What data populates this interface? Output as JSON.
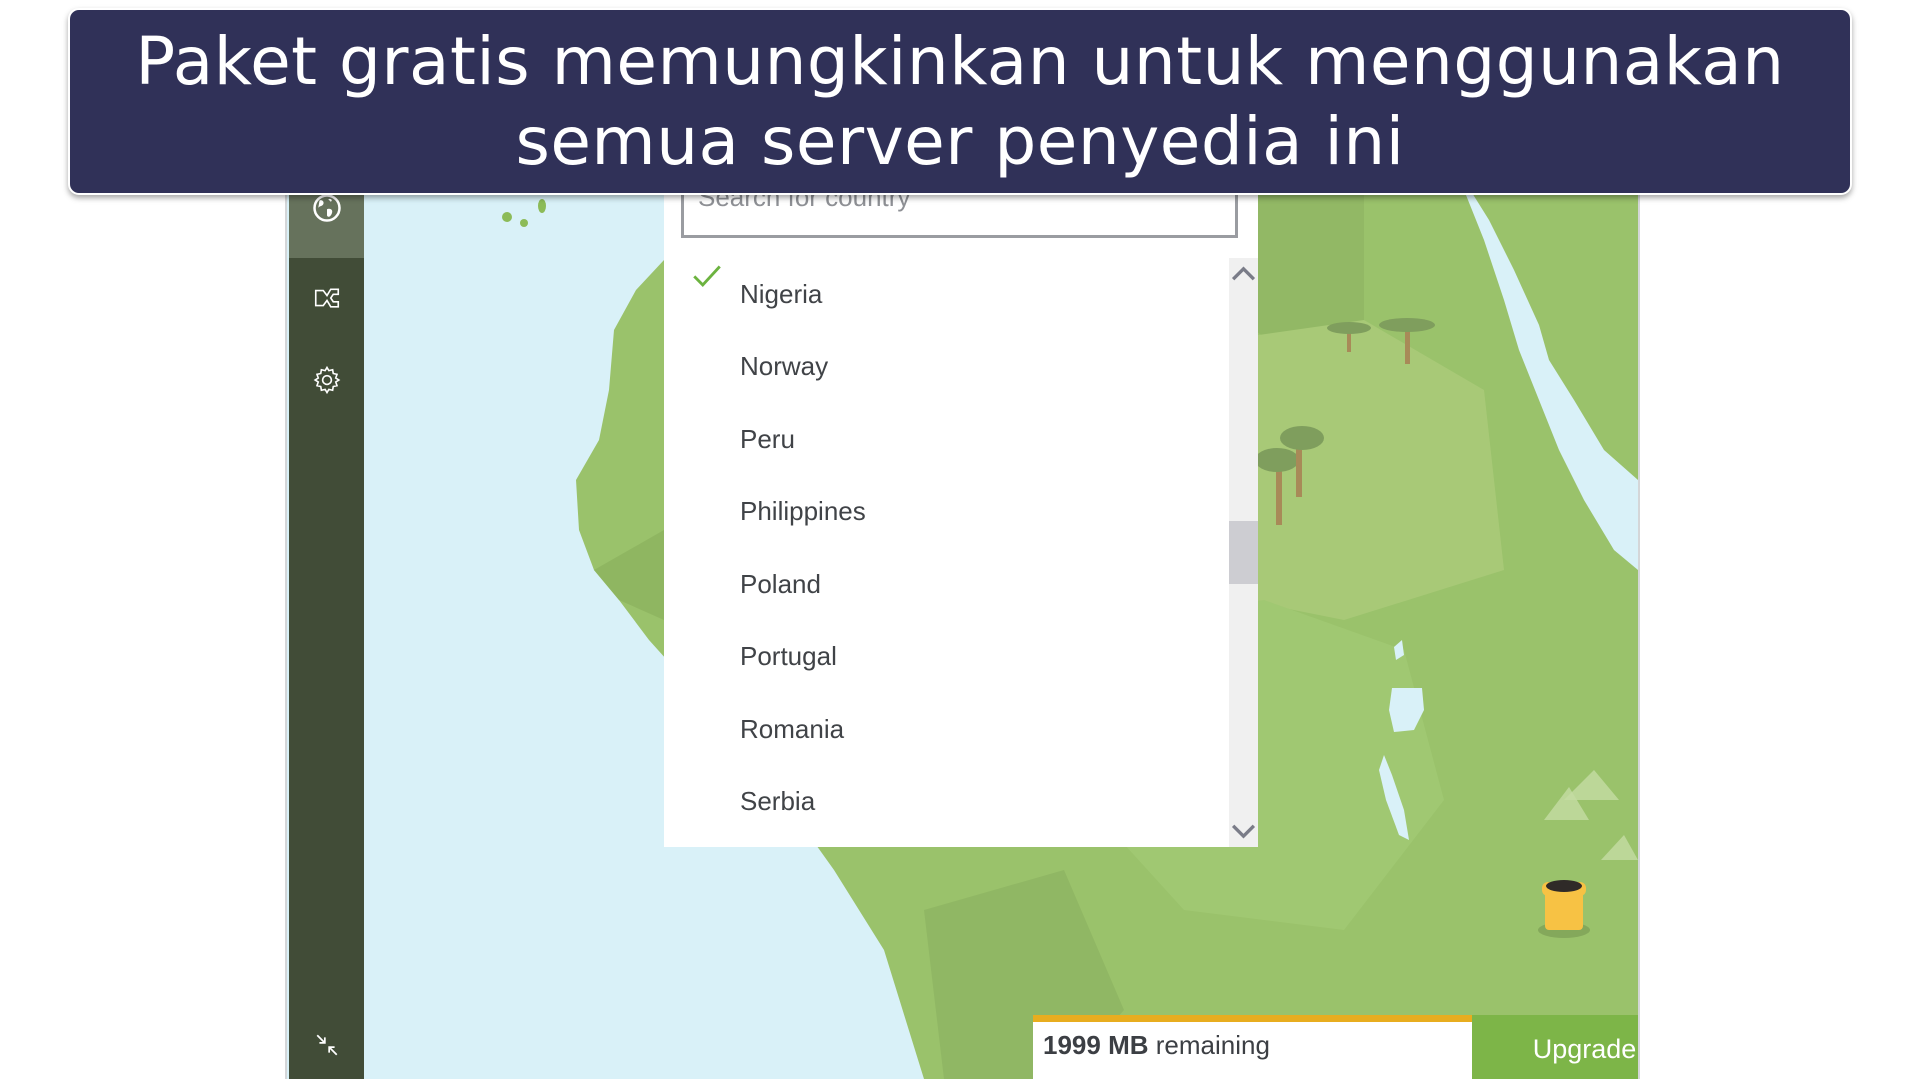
{
  "banner": {
    "line1": "Paket gratis memungkinkan untuk menggunakan",
    "line2": "semua server penyedia ini",
    "color": "#303158"
  },
  "sidebar": {
    "items": [
      {
        "icon": "globe-icon",
        "active": true
      },
      {
        "icon": "split-tunnel-icon",
        "active": false
      },
      {
        "icon": "gear-icon",
        "active": false
      }
    ],
    "bottom_icon": "minimize-icon"
  },
  "search": {
    "placeholder": "Search for country",
    "value": ""
  },
  "countries": [
    {
      "name": "Nigeria",
      "selected": true
    },
    {
      "name": "Norway",
      "selected": false
    },
    {
      "name": "Peru",
      "selected": false
    },
    {
      "name": "Philippines",
      "selected": false
    },
    {
      "name": "Poland",
      "selected": false
    },
    {
      "name": "Portugal",
      "selected": false
    },
    {
      "name": "Romania",
      "selected": false
    },
    {
      "name": "Serbia",
      "selected": false
    }
  ],
  "scroll": {
    "position_fraction": 0.5,
    "visible_fraction": 0.12
  },
  "data_usage": {
    "amount": "1999 MB",
    "suffix": "remaining",
    "remaining_fraction": 0.9995,
    "bar_color": "#e8ad1f"
  },
  "upgrade": {
    "label": "Upgrade",
    "color": "#7db548"
  },
  "map": {
    "ocean_color": "#d9f1f8",
    "land_color": "#9ac26b"
  }
}
